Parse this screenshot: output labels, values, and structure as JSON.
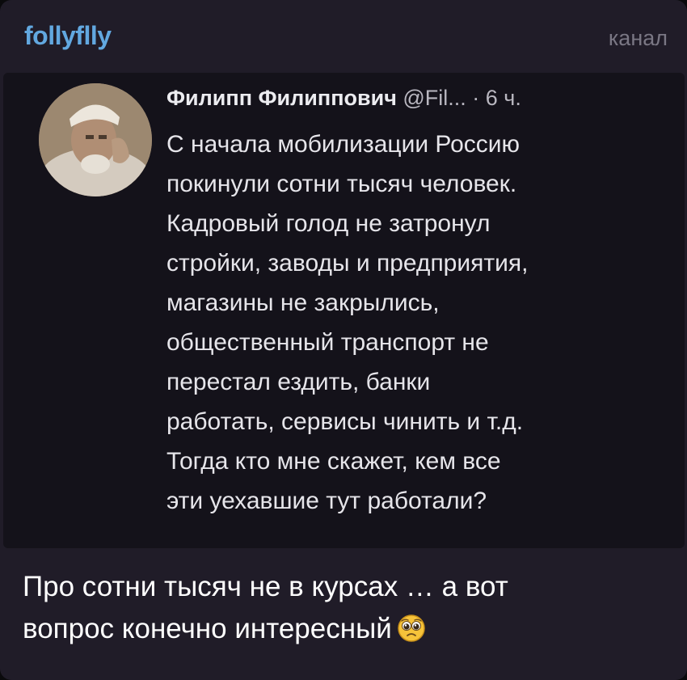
{
  "header": {
    "channel_name": "follyflly",
    "channel_type": "канал"
  },
  "tweet": {
    "author_name": "Филипп Филиппович",
    "author_handle_time": " @Fil... · 6 ч.",
    "text": "С начала мобилизации Россию\nпокинули сотни тысяч человек.\nКадровый голод не затронул\nстройки, заводы и предприятия,\nмагазины не закрылись,\nобщественный транспорт не\nперестал ездить, банки\nработать, сервисы чинить и т.д.\nТогда кто мне скажет, кем все\nэти уехавшие тут работали?"
  },
  "comment": {
    "text": "Про сотни тысяч не в курсах … а вот\nвопрос конечно интересный",
    "emoji": "pleading-face-icon"
  },
  "colors": {
    "card_bg": "#201c28",
    "tweet_bg": "#14121a",
    "channel_name": "#62a8e0",
    "channel_type": "#7a7784"
  }
}
